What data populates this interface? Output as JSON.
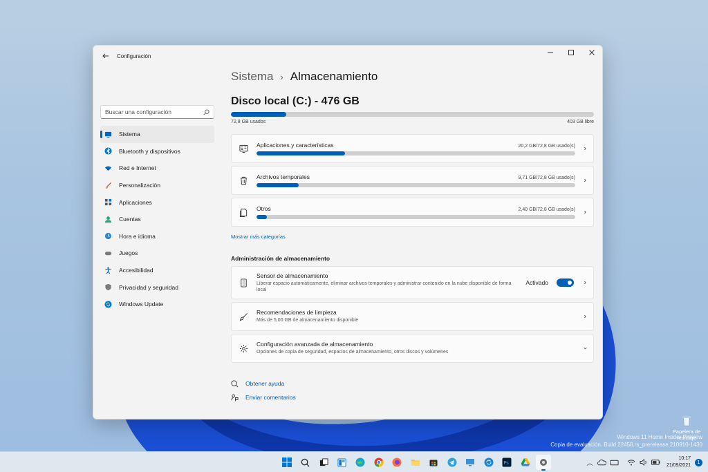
{
  "window": {
    "title": "Configuración"
  },
  "sidebar": {
    "search_placeholder": "Buscar una configuración",
    "items": [
      {
        "label": "Sistema",
        "icon": "monitor-icon",
        "color": "#0067c0"
      },
      {
        "label": "Bluetooth y dispositivos",
        "icon": "bluetooth-icon",
        "color": "#0078d4"
      },
      {
        "label": "Red e Internet",
        "icon": "wifi-icon",
        "color": "#0067c0"
      },
      {
        "label": "Personalización",
        "icon": "brush-icon",
        "color": "#c2602f"
      },
      {
        "label": "Aplicaciones",
        "icon": "apps-icon",
        "color": "#4c5a6b"
      },
      {
        "label": "Cuentas",
        "icon": "person-icon",
        "color": "#27a578"
      },
      {
        "label": "Hora e idioma",
        "icon": "globe-clock-icon",
        "color": "#2b88d8"
      },
      {
        "label": "Juegos",
        "icon": "gamepad-icon",
        "color": "#7a7a7a"
      },
      {
        "label": "Accesibilidad",
        "icon": "accessibility-icon",
        "color": "#0067c0"
      },
      {
        "label": "Privacidad y seguridad",
        "icon": "shield-icon",
        "color": "#7a7a7a"
      },
      {
        "label": "Windows Update",
        "icon": "update-icon",
        "color": "#0078d4"
      }
    ]
  },
  "main": {
    "breadcrumb_parent": "Sistema",
    "breadcrumb_sep": "›",
    "breadcrumb_current": "Almacenamiento",
    "disk_title": "Disco local (C:) - 476 GB",
    "disk_used_label": "72,8 GB usados",
    "disk_free_label": "403 GB libre",
    "disk_used_fraction": 0.153,
    "categories": [
      {
        "label": "Aplicaciones y características",
        "amount": "20,2 GB/72,8 GB usado(s)",
        "fraction": 0.277,
        "icon": "apps-list-icon"
      },
      {
        "label": "Archivos temporales",
        "amount": "9,71 GB/72,8 GB usado(s)",
        "fraction": 0.133,
        "icon": "trash-icon"
      },
      {
        "label": "Otros",
        "amount": "2,40 GB/72,8 GB usado(s)",
        "fraction": 0.033,
        "icon": "document-icon"
      }
    ],
    "more_categories": "Mostrar más categorías",
    "management_title": "Administración de almacenamiento",
    "sense": {
      "title": "Sensor de almacenamiento",
      "desc": "Liberar espacio automáticamente, eliminar archivos temporales y administrar contenido en la nube disponible de forma local",
      "toggle_label": "Activado"
    },
    "cleanup": {
      "title": "Recomendaciones de limpieza",
      "desc": "Más de 5,00 GB de almacenamiento disponible"
    },
    "advanced": {
      "title": "Configuración avanzada de almacenamiento",
      "desc": "Opciones de copia de seguridad, espacios de almacenamiento, otros discos y volúmenes"
    },
    "help_label": "Obtener ayuda",
    "feedback_label": "Enviar comentarios"
  },
  "desktop": {
    "recycle_label": "Papelera de reciclaje",
    "watermark_line1": "Windows 11 Home Insider Preview",
    "watermark_line2": "Copia de evaluación. Build 22458.rs_prerelease.210910-1430"
  },
  "taskbar": {
    "time": "10:17",
    "date": "21/09/2021",
    "notification_count": "1"
  },
  "colors": {
    "accent": "#005fb8",
    "track": "#cfcfcf"
  }
}
